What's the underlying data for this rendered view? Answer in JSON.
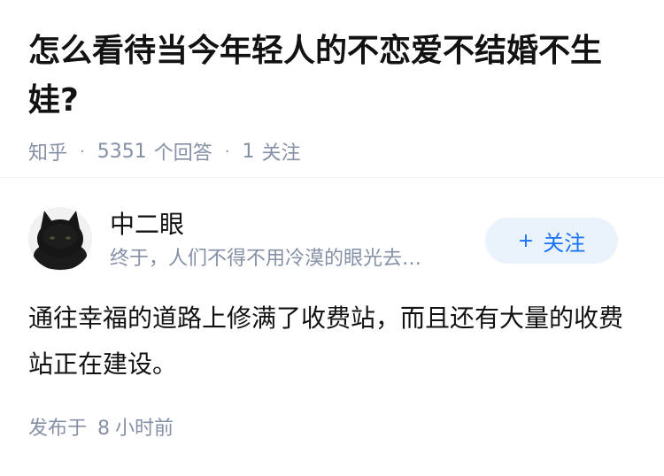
{
  "question": {
    "title": "怎么看待当今年轻人的不恋爱不结婚不生娃?",
    "source": "知乎",
    "separator": "·",
    "answer_count": "5351",
    "answer_label": "个回答",
    "follow_count": "1",
    "follow_label": "关注"
  },
  "answer": {
    "author_name": "中二眼",
    "author_bio": "终于，人们不得不用冷漠的眼光去…",
    "follow_button": {
      "plus": "+",
      "label": "关注"
    },
    "content": "通往幸福的道路上修满了收费站，而且还有大量的收费站正在建设。",
    "published_prefix": "发布于",
    "published_value": "8",
    "published_unit": "小时前"
  },
  "colors": {
    "accent": "#1772f6",
    "button_bg": "#eaf2fc",
    "meta_text": "#8590a6",
    "primary_text": "#121212"
  }
}
